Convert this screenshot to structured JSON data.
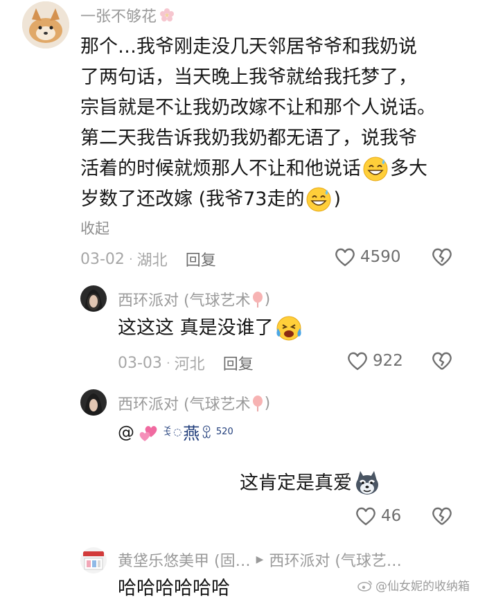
{
  "comment": {
    "username": "一张不够花",
    "lines": [
      "那个…我爷刚走没几天邻居爷爷和我奶说",
      "了两句话，当天晚上我爷就给我托梦了，",
      "宗旨就是不让我奶改嫁不让和那个人说话。",
      "第二天我告诉我奶我奶都无语了，说我爷",
      "活着的时候就烦那人不让和他说话",
      "多大",
      "岁数了还改嫁 (我爷73走的",
      ")"
    ],
    "collapse": "收起",
    "date": "03-02",
    "region": "湖北",
    "reply": "回复",
    "likes": "4590"
  },
  "reply1": {
    "username": "西环派对 (气球艺术",
    "username_close": ")",
    "text": "这这这 真是没谁了",
    "date": "03-03",
    "region": "河北",
    "reply": "回复",
    "likes": "922"
  },
  "reply2": {
    "username": "西环派对 (气球艺术",
    "username_close": ")",
    "mention": "@",
    "decor_text": "燕",
    "decor_num": "520",
    "sticker_caption": "这肯定是真爱",
    "likes": "46"
  },
  "reply3": {
    "username": "黄垡乐悠美甲 (固…",
    "arrow": "▶",
    "target": "西环派对 (气球艺…",
    "text": "哈哈哈哈哈哈"
  },
  "watermark": "@仙女妮的收纳箱",
  "colors": {
    "text": "#161616",
    "muted": "#a6a6a6",
    "username": "#9a9a9a",
    "heart_outline": "#6e6e6e"
  },
  "icons": {
    "like": "heart-outline-icon",
    "dislike": "broken-heart-icon",
    "flower": "cherry-blossom-icon",
    "balloon": "balloon-icon"
  }
}
